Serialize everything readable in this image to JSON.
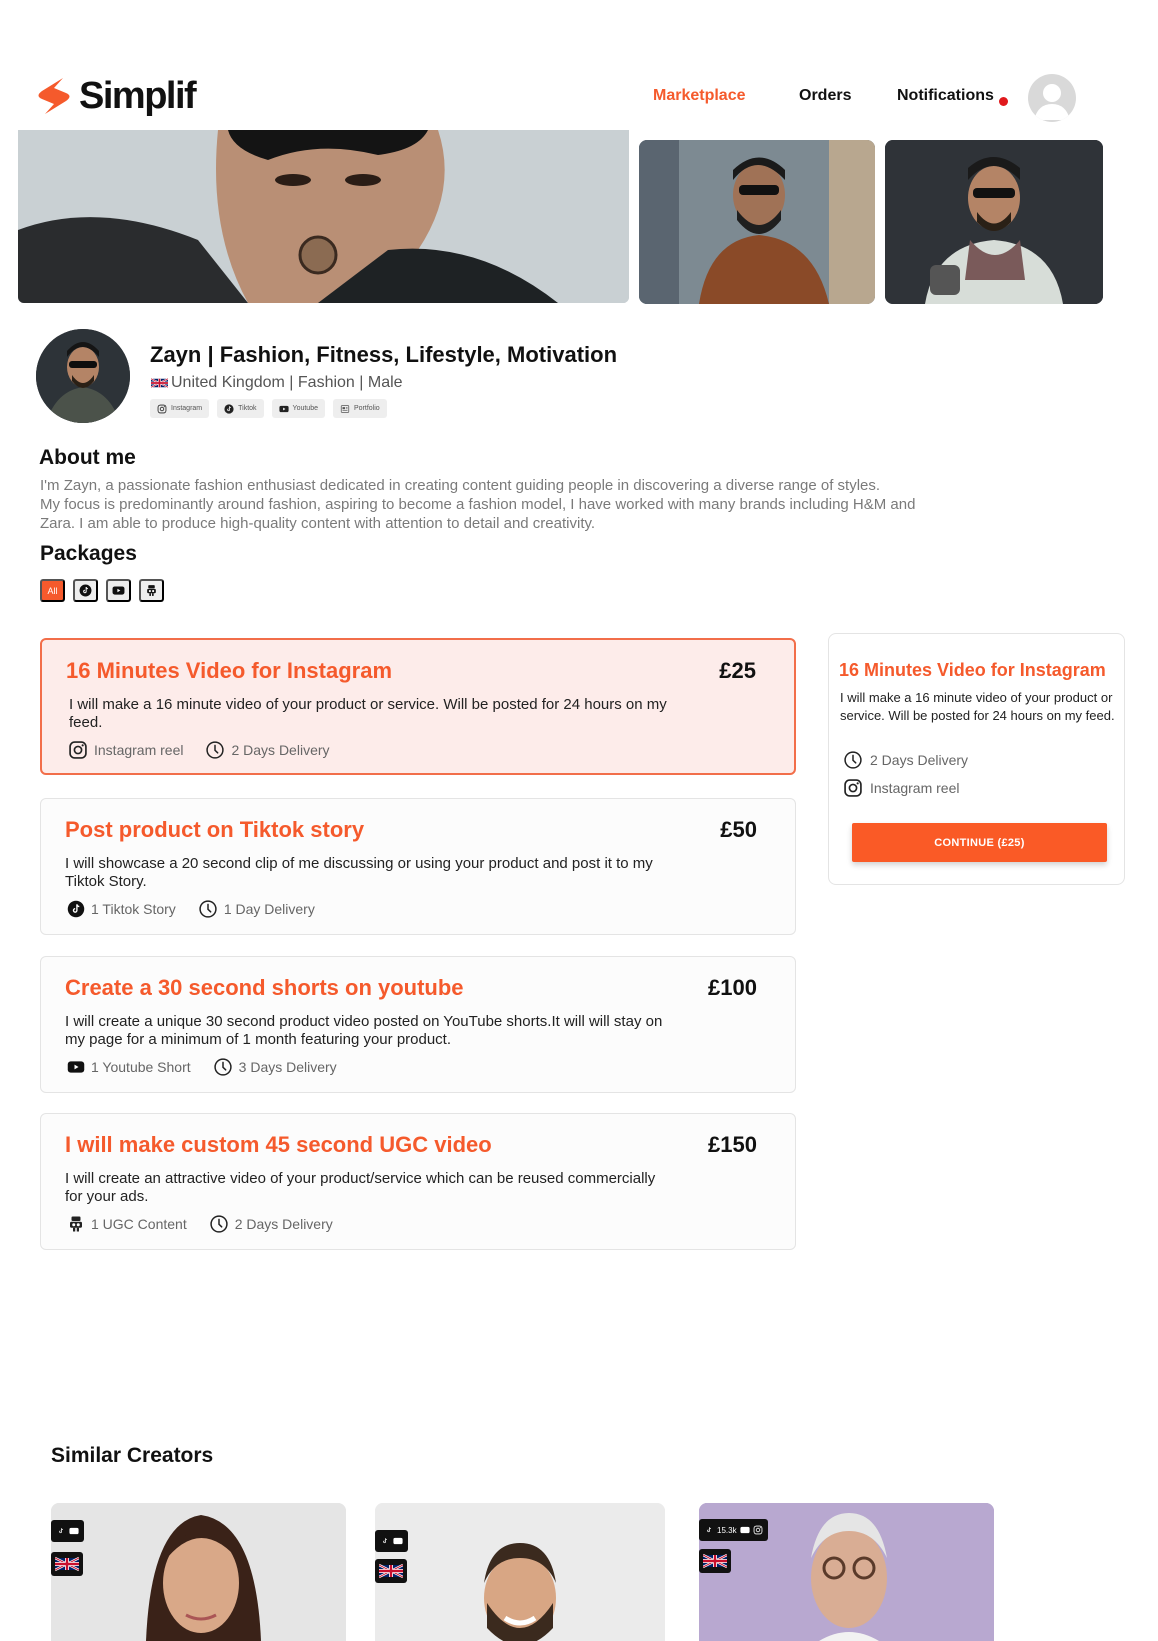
{
  "brand": {
    "name": "Simplif",
    "accent": "#f55a2c"
  },
  "nav": {
    "marketplace": "Marketplace",
    "orders": "Orders",
    "notifications": "Notifications"
  },
  "profile": {
    "name": "Zayn | Fashion, Fitness, Lifestyle, Motivation",
    "location_line": "United Kingdom | Fashion | Male",
    "socials": [
      "Instagram",
      "Tiktok",
      "Youtube",
      "Portfolio"
    ]
  },
  "about": {
    "title": "About me",
    "lines": [
      "I'm Zayn, a passionate fashion enthusiast dedicated in creating content guiding people in discovering a diverse range of styles.",
      "My focus is predominantly around fashion, aspiring to become a fashion model, I have worked with many brands including H&M and",
      "Zara. I am able to produce high-quality content with attention to detail and creativity."
    ]
  },
  "packages": {
    "title": "Packages",
    "filter_all": "All",
    "filter_icons": [
      "tiktok-icon",
      "youtube-icon",
      "ugc-icon"
    ],
    "items": [
      {
        "title": "16 Minutes Video for Instagram",
        "price": "£25",
        "description": "I will make a 16 minute video of your product or service. Will be posted for 24 hours on my feed.",
        "deliverable": "Instagram reel",
        "delivery": "2 Days Delivery"
      },
      {
        "title": "Post product on Tiktok story",
        "price": "£50",
        "description": "I will showcase a 20 second clip of me discussing or using your product and post it to my Tiktok Story.",
        "deliverable": "1 Tiktok Story",
        "delivery": "1 Day Delivery"
      },
      {
        "title": "Create a 30 second shorts on youtube",
        "price": "£100",
        "description": "I will create a unique  30 second product video  posted on YouTube shorts.It will will stay on my page for a minimum of 1 month featuring your product.",
        "deliverable": "1 Youtube Short",
        "delivery": "3 Days Delivery"
      },
      {
        "title": "I will make custom 45 second UGC video",
        "price": "£150",
        "description": "I will create an attractive video of your product/service which can be reused commercially for your ads.",
        "deliverable": "1 UGC Content",
        "delivery": "2 Days Delivery"
      }
    ]
  },
  "summary": {
    "title": "16 Minutes Video for Instagram",
    "description": "I will make a 16 minute video of your product or service. Will be posted for 24 hours on my feed.",
    "delivery": "2 Days Delivery",
    "deliverable": "Instagram reel",
    "button": "CONTINUE (£25)"
  },
  "similar": {
    "title": "Similar Creators",
    "creators": [
      {
        "platforms": [
          "tiktok",
          "youtube"
        ],
        "followers": "",
        "country": "United Kingdom"
      },
      {
        "platforms": [
          "tiktok",
          "youtube"
        ],
        "followers": "",
        "country": "United Kingdom"
      },
      {
        "platforms": [
          "tiktok",
          "youtube",
          "instagram"
        ],
        "followers": "15.3k",
        "country": "United Kingdom"
      }
    ]
  }
}
